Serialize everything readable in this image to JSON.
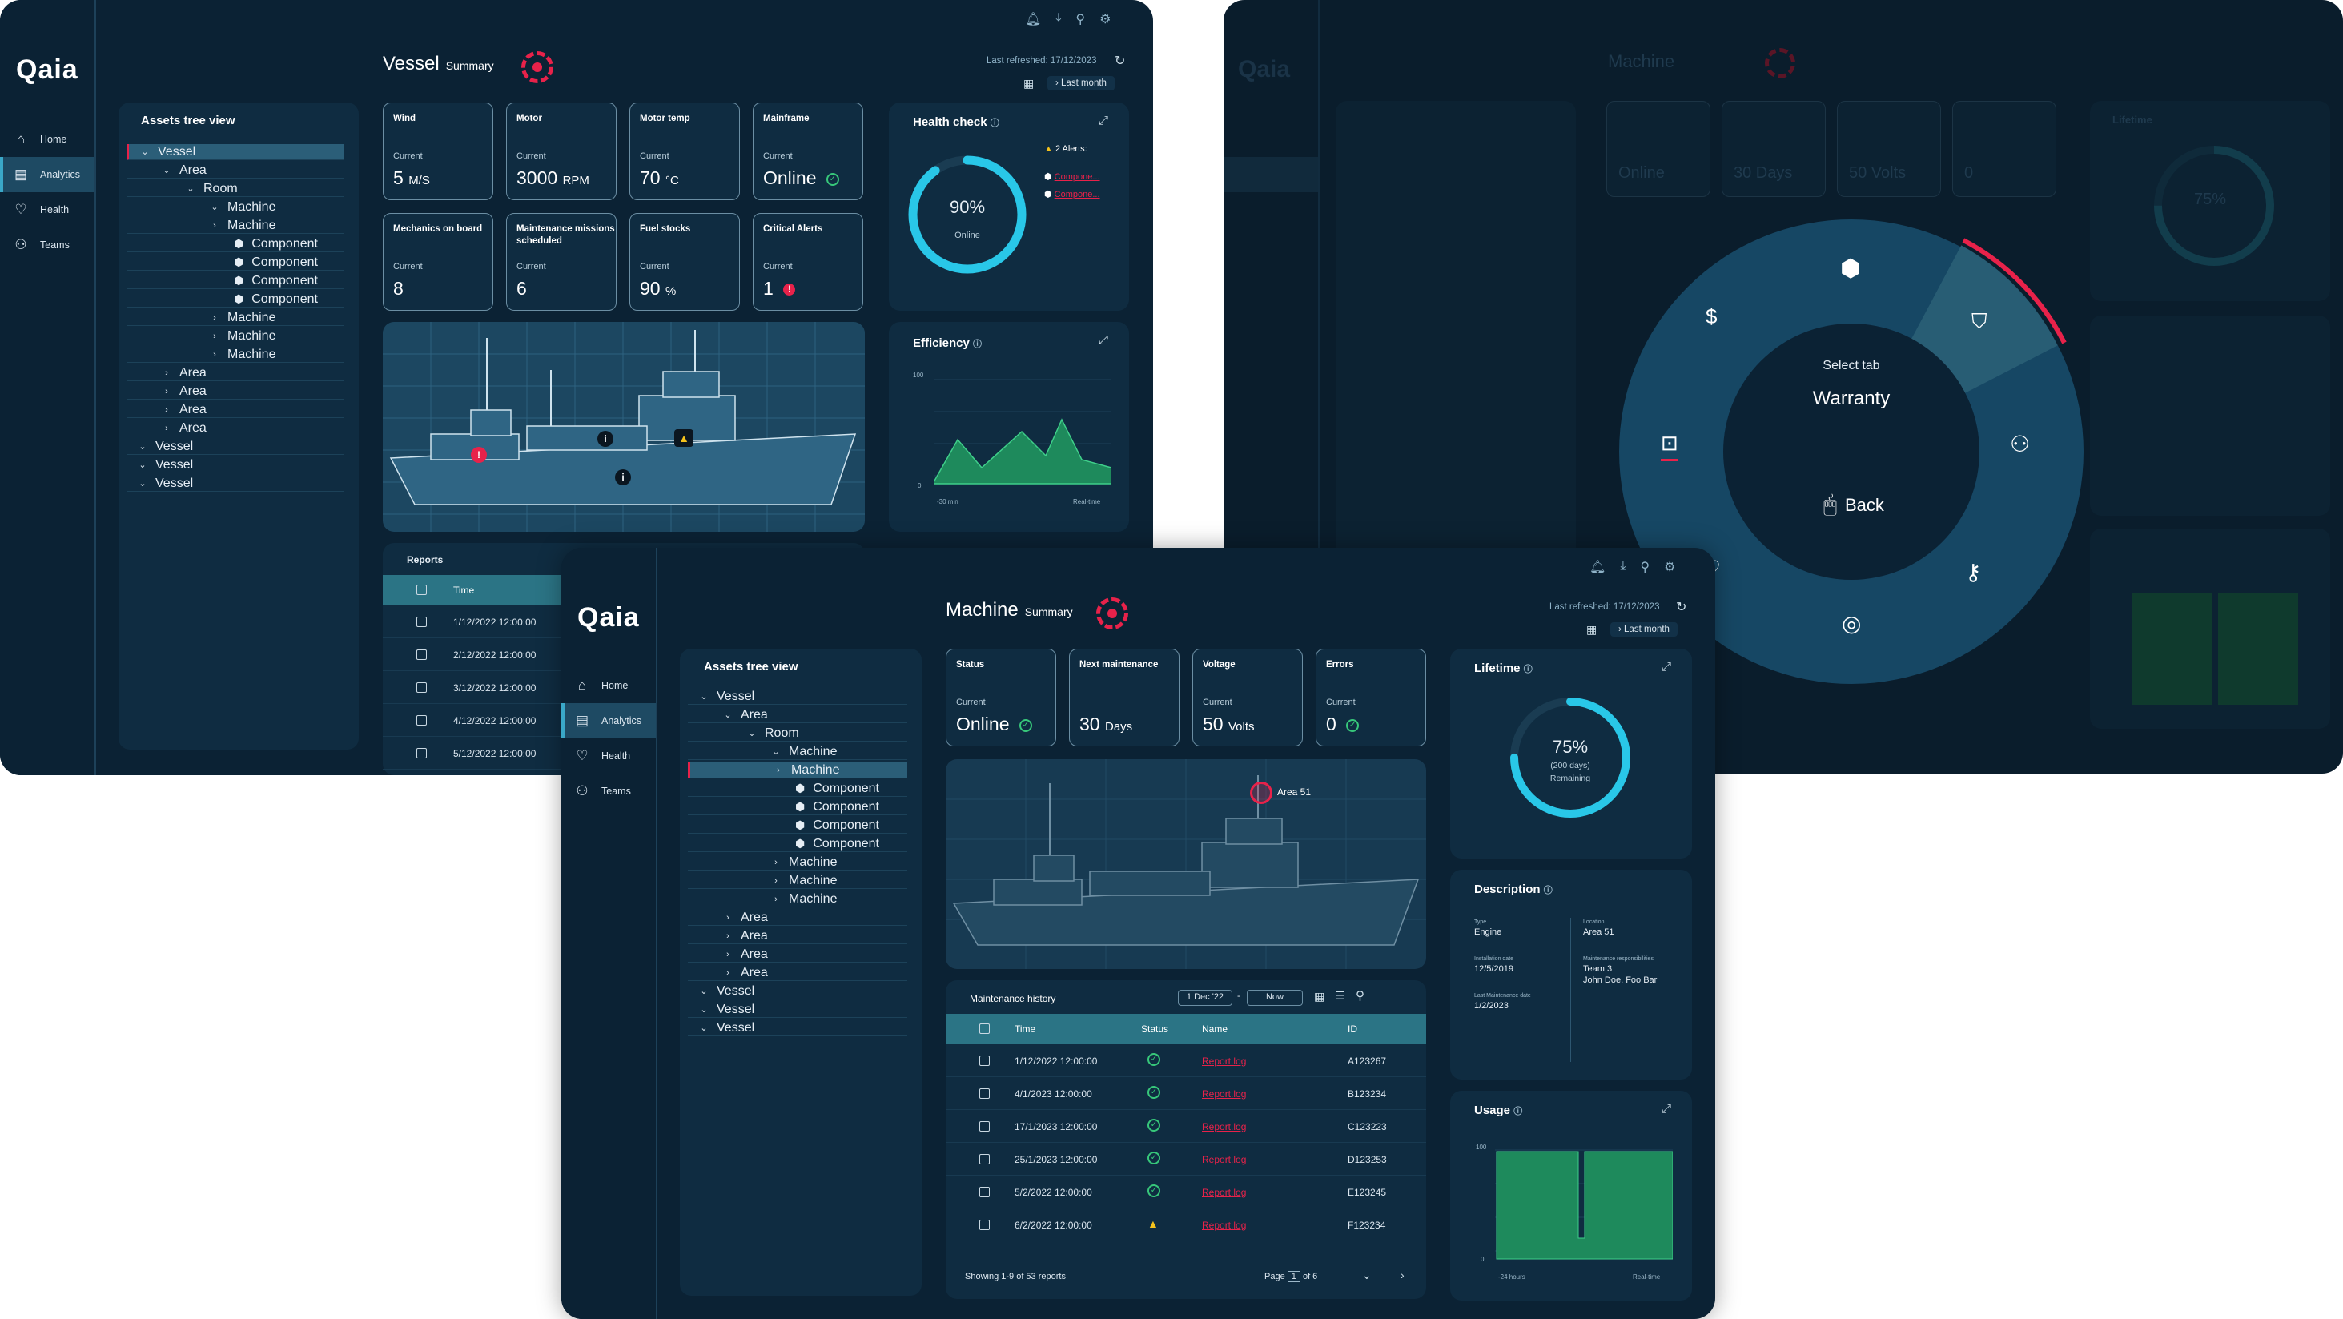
{
  "nav": {
    "items": [
      {
        "label": "Home",
        "icon": "home-icon"
      },
      {
        "label": "Analytics",
        "icon": "analytics-icon"
      },
      {
        "label": "Health",
        "icon": "health-icon"
      },
      {
        "label": "Teams",
        "icon": "teams-icon"
      }
    ]
  },
  "brand": "Qaia",
  "vessel": {
    "title": "Vessel",
    "subtitle": "Summary",
    "last_refreshed": "Last refreshed: 17/12/2023",
    "period": "Last month",
    "tree_title": "Assets tree view",
    "tree": [
      {
        "label": "Vessel",
        "level": 0,
        "chev": "down",
        "sel": true
      },
      {
        "label": "Area",
        "level": 1,
        "chev": "down"
      },
      {
        "label": "Room",
        "level": 2,
        "chev": "down"
      },
      {
        "label": "Machine",
        "level": 3,
        "chev": "down"
      },
      {
        "label": "Machine",
        "level": 3,
        "chev": "right"
      },
      {
        "label": "Component",
        "level": 4,
        "cube": true
      },
      {
        "label": "Component",
        "level": 4,
        "cube": true
      },
      {
        "label": "Component",
        "level": 4,
        "cube": true
      },
      {
        "label": "Component",
        "level": 4,
        "cube": true
      },
      {
        "label": "Machine",
        "level": 3,
        "chev": "right"
      },
      {
        "label": "Machine",
        "level": 3,
        "chev": "right"
      },
      {
        "label": "Machine",
        "level": 3,
        "chev": "right"
      },
      {
        "label": "Area",
        "level": 1,
        "chev": "right"
      },
      {
        "label": "Area",
        "level": 1,
        "chev": "right"
      },
      {
        "label": "Area",
        "level": 1,
        "chev": "right"
      },
      {
        "label": "Area",
        "level": 1,
        "chev": "right"
      },
      {
        "label": "Vessel",
        "level": 0,
        "chev": "down"
      },
      {
        "label": "Vessel",
        "level": 0,
        "chev": "down"
      },
      {
        "label": "Vessel",
        "level": 0,
        "chev": "down"
      }
    ],
    "cards": [
      {
        "label": "Wind",
        "current": "Current",
        "value": "5",
        "unit": "M/S"
      },
      {
        "label": "Motor",
        "current": "Current",
        "value": "3000",
        "unit": "RPM"
      },
      {
        "label": "Motor temp",
        "current": "Current",
        "value": "70",
        "unit": "°C"
      },
      {
        "label": "Mainframe",
        "current": "Current",
        "value": "Online",
        "unit": "",
        "status": "ok"
      },
      {
        "label": "Mechanics on board",
        "current": "Current",
        "value": "8",
        "unit": ""
      },
      {
        "label": "Maintenance missions scheduled",
        "current": "Current",
        "value": "6",
        "unit": ""
      },
      {
        "label": "Fuel stocks",
        "current": "Current",
        "value": "90",
        "unit": "%"
      },
      {
        "label": "Critical Alerts",
        "current": "Current",
        "value": "1",
        "unit": "",
        "status": "crit"
      }
    ],
    "health": {
      "title": "Health check",
      "value": "90%",
      "fraction": 0.9,
      "label": "Online",
      "alerts": "2 Alerts:",
      "items": [
        "Compone...",
        "Compone..."
      ]
    },
    "efficiency": {
      "title": "Efficiency",
      "ymax": "100",
      "ymin": "0",
      "xstart": "-30 min",
      "xend": "Real-time"
    },
    "reports": {
      "title": "Reports",
      "header": "Time",
      "rows": [
        "1/12/2022 12:00:00",
        "2/12/2022 12:00:00",
        "3/12/2022 12:00:00",
        "4/12/2022 12:00:00",
        "5/12/2022 12:00:00"
      ]
    }
  },
  "machine_bg": {
    "title": "Machine",
    "subtitle": "Summary",
    "status_value": "Online",
    "maint_value": "30 Days",
    "volt_value": "50 Volts",
    "err_value": "0",
    "lifetime": "Lifetime",
    "pct": "75%"
  },
  "radial_menu": {
    "select_tab": "Select tab",
    "selected": "Warranty",
    "back": "Back",
    "icons": [
      "cube-icon",
      "warranty-shield-icon",
      "teams-icon",
      "key-icon",
      "support-icon",
      "health-icon",
      "notes-icon",
      "dollar-icon"
    ]
  },
  "machine": {
    "title": "Machine",
    "subtitle": "Summary",
    "last_refreshed": "Last refreshed: 17/12/2023",
    "period": "Last month",
    "tree_title": "Assets tree view",
    "tree": [
      {
        "label": "Vessel",
        "level": 0,
        "chev": "down"
      },
      {
        "label": "Area",
        "level": 1,
        "chev": "down"
      },
      {
        "label": "Room",
        "level": 2,
        "chev": "down"
      },
      {
        "label": "Machine",
        "level": 3,
        "chev": "down"
      },
      {
        "label": "Machine",
        "level": 3,
        "chev": "right",
        "sel": true
      },
      {
        "label": "Component",
        "level": 4,
        "cube": true
      },
      {
        "label": "Component",
        "level": 4,
        "cube": true
      },
      {
        "label": "Component",
        "level": 4,
        "cube": true
      },
      {
        "label": "Component",
        "level": 4,
        "cube": true
      },
      {
        "label": "Machine",
        "level": 3,
        "chev": "right"
      },
      {
        "label": "Machine",
        "level": 3,
        "chev": "right"
      },
      {
        "label": "Machine",
        "level": 3,
        "chev": "right"
      },
      {
        "label": "Area",
        "level": 1,
        "chev": "right"
      },
      {
        "label": "Area",
        "level": 1,
        "chev": "right"
      },
      {
        "label": "Area",
        "level": 1,
        "chev": "right"
      },
      {
        "label": "Area",
        "level": 1,
        "chev": "right"
      },
      {
        "label": "Vessel",
        "level": 0,
        "chev": "down"
      },
      {
        "label": "Vessel",
        "level": 0,
        "chev": "down"
      },
      {
        "label": "Vessel",
        "level": 0,
        "chev": "down"
      }
    ],
    "cards": [
      {
        "label": "Status",
        "current": "Current",
        "value": "Online",
        "unit": "",
        "status": "ok"
      },
      {
        "label": "Next maintenance",
        "current": "",
        "value": "30",
        "unit": "Days"
      },
      {
        "label": "Voltage",
        "current": "Current",
        "value": "50",
        "unit": "Volts"
      },
      {
        "label": "Errors",
        "current": "Current",
        "value": "0",
        "unit": "",
        "status": "ok"
      }
    ],
    "area_label": "Area 51",
    "lifetime": {
      "title": "Lifetime",
      "value": "75%",
      "fraction": 0.75,
      "days": "(200 days)",
      "label": "Remaining"
    },
    "description": {
      "title": "Description",
      "type_label": "Type",
      "type": "Engine",
      "install_label": "Installation date",
      "install": "12/5/2019",
      "lastmaint_label": "Last Maintenance date",
      "lastmaint": "1/2/2023",
      "location_label": "Location",
      "location": "Area 51",
      "resp_label": "Maintenance responsibilities",
      "resp_team": "Team 3",
      "resp_people": "John Doe, Foo Bar"
    },
    "usage": {
      "title": "Usage",
      "ymax": "100",
      "ymin": "0",
      "xstart": "-24 hours",
      "xend": "Real-time"
    },
    "history": {
      "title": "Maintenance history",
      "date_from": "1 Dec '22",
      "date_sep": "-",
      "date_to": "Now",
      "columns": [
        "Time",
        "Status",
        "Name",
        "ID"
      ],
      "rows": [
        {
          "time": "1/12/2022 12:00:00",
          "status": "ok",
          "name": "Report.log",
          "id": "A123267"
        },
        {
          "time": "4/1/2023 12:00:00",
          "status": "ok",
          "name": "Report.log",
          "id": "B123234"
        },
        {
          "time": "17/1/2023 12:00:00",
          "status": "ok",
          "name": "Report.log",
          "id": "C123223"
        },
        {
          "time": "25/1/2023 12:00:00",
          "status": "ok",
          "name": "Report.log",
          "id": "D123253"
        },
        {
          "time": "5/2/2022 12:00:00",
          "status": "ok",
          "name": "Report.log",
          "id": "E123245"
        },
        {
          "time": "6/2/2022 12:00:00",
          "status": "warn",
          "name": "Report.log",
          "id": "F123234"
        }
      ],
      "showing": "Showing 1-9 of 53 reports",
      "page_label": "Page",
      "page": "1",
      "of": "of 6"
    }
  }
}
